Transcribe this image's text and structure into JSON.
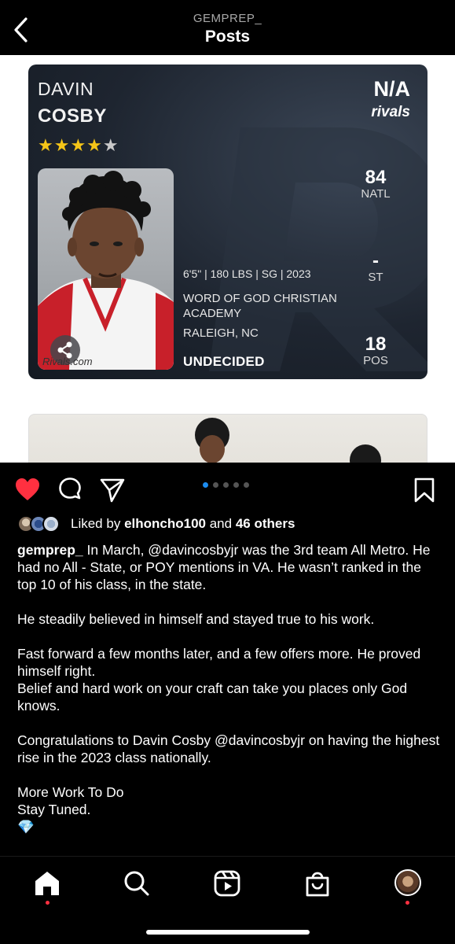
{
  "header": {
    "account": "GEMPREP_",
    "title": "Posts"
  },
  "card": {
    "first_name": "DAVIN",
    "last_name": "COSBY",
    "stars_filled": 4,
    "stars_total": 5,
    "rating": "N/A",
    "brand": "rivals",
    "photo_credit": "Rivals.com",
    "natl_value": "84",
    "natl_label": "NATL",
    "st_value": "-",
    "st_label": "ST",
    "pos_value": "18",
    "pos_label": "POS",
    "stats_line": "6'5\"  |  180 LBS  |  SG  |  2023",
    "school": "WORD OF GOD CHRISTIAN ACADEMY",
    "location": "RALEIGH, NC",
    "status": "UNDECIDED"
  },
  "carousel": {
    "count": 5,
    "active": 0
  },
  "likes": {
    "prefix": "Liked by ",
    "user": "elhoncho100",
    "middle": " and ",
    "others": "46 others"
  },
  "caption": {
    "username": "gemprep_",
    "p1": " In March, @davincosbyjr was the 3rd team All Metro.  He had no All - State, or POY mentions in VA. He wasn’t ranked in the top 10 of his class, in the state.",
    "p2": "He steadily believed in himself and stayed true to his work.",
    "p3": "Fast forward a few months later, and a few offers more. He proved himself right.",
    "p4": "Belief and hard work on your craft can take you places only God knows.",
    "p5": "Congratulations to Davin Cosby @davincosbyjr on having the highest rise in the 2023 class nationally.",
    "p6": "More Work To Do",
    "p7": "Stay Tuned.",
    "p8": "💎"
  },
  "colors": {
    "like_red": "#ff3040",
    "dot_active": "#1c8cf0",
    "star_gold": "#f5c518"
  },
  "icons": [
    "back-icon",
    "heart-icon",
    "comment-icon",
    "share-icon",
    "bookmark-icon",
    "home-icon",
    "search-icon",
    "reels-icon",
    "shop-icon",
    "profile-avatar"
  ]
}
